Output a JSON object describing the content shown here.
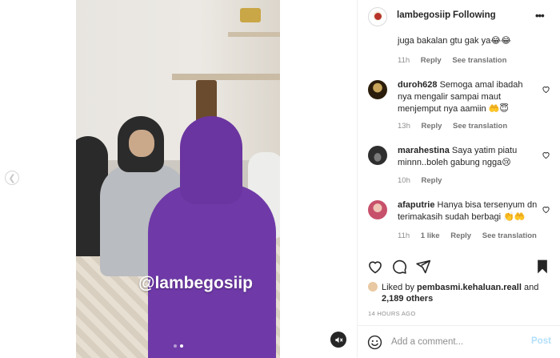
{
  "colors": {
    "accent": "#0095f6",
    "post_disabled": "#b2dffc",
    "text": "#262626",
    "muted": "#8e8e8e",
    "video_purple": "#6f3aa8"
  },
  "media": {
    "watermark": "@lambegosiip",
    "carousel_dots": 2,
    "active_dot": 1,
    "prev_icon": "chevron-left-icon",
    "mute_icon": "speaker-muted-icon"
  },
  "header": {
    "username": "lambegosiip",
    "separator": "•",
    "follow_label": "Following",
    "more_icon": "more-horizontal-icon"
  },
  "comments": [
    {
      "username": "",
      "text": "juga bakalan gtu gak ya😂😂",
      "time": "11h",
      "likes": "",
      "reply": "Reply",
      "translate": "See translation",
      "avatar_color": ""
    },
    {
      "username": "duroh628",
      "text": "Semoga amal ibadah nya mengalir sampai maut menjemput nya aamiin 🤲😇",
      "time": "13h",
      "likes": "",
      "reply": "Reply",
      "translate": "See translation",
      "avatar_color": "#3a2a12"
    },
    {
      "username": "marahestina",
      "text": "Saya yatim piatu minnn..boleh gabung ngga😢",
      "time": "10h",
      "likes": "",
      "reply": "Reply",
      "translate": "",
      "avatar_color": "#4a4a4a"
    },
    {
      "username": "afaputrie",
      "text": "Hanya bisa tersenyum dn terimakasih sudah berbagi 👏🤲",
      "time": "11h",
      "likes": "1 like",
      "reply": "Reply",
      "translate": "See translation",
      "avatar_color": "#c75a6b"
    }
  ],
  "actions": {
    "like_icon": "heart-icon",
    "comment_icon": "comment-icon",
    "share_icon": "send-icon",
    "save_icon": "bookmark-icon"
  },
  "likes": {
    "prefix": "Liked by",
    "user": "pembasmi.kehaluan.reall",
    "and": "and",
    "others": "2,189 others"
  },
  "time_ago": "14 HOURS AGO",
  "add_comment": {
    "placeholder": "Add a comment...",
    "post_label": "Post",
    "emoji_icon": "emoji-icon"
  }
}
